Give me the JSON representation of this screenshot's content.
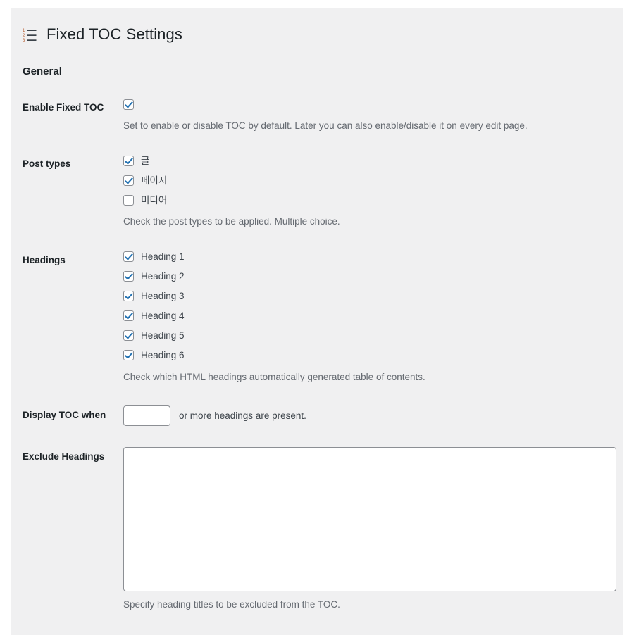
{
  "page": {
    "title": "Fixed TOC Settings",
    "title_icon": "ordered-list-icon",
    "section_heading": "General",
    "accent_color": "#2271b1",
    "background_color": "#f0f0f1",
    "text_color": "#1d2327",
    "description_color": "#646970"
  },
  "fields": {
    "enable_fixed_toc": {
      "label": "Enable Fixed TOC",
      "checked": true,
      "description": "Set to enable or disable TOC by default. Later you can also enable/disable it on every edit page."
    },
    "post_types": {
      "label": "Post types",
      "options": [
        {
          "label": "글",
          "checked": true
        },
        {
          "label": "페이지",
          "checked": true
        },
        {
          "label": "미디어",
          "checked": false
        }
      ],
      "description": "Check the post types to be applied. Multiple choice."
    },
    "headings": {
      "label": "Headings",
      "options": [
        {
          "label": "Heading 1",
          "checked": true
        },
        {
          "label": "Heading 2",
          "checked": true
        },
        {
          "label": "Heading 3",
          "checked": true
        },
        {
          "label": "Heading 4",
          "checked": true
        },
        {
          "label": "Heading 5",
          "checked": true
        },
        {
          "label": "Heading 6",
          "checked": true
        }
      ],
      "description": "Check which HTML headings automatically generated table of contents."
    },
    "display_toc_when": {
      "label": "Display TOC when",
      "value": "",
      "suffix_text": "or more headings are present."
    },
    "exclude_headings": {
      "label": "Exclude Headings",
      "value": "",
      "description": "Specify heading titles to be excluded from the TOC."
    }
  }
}
